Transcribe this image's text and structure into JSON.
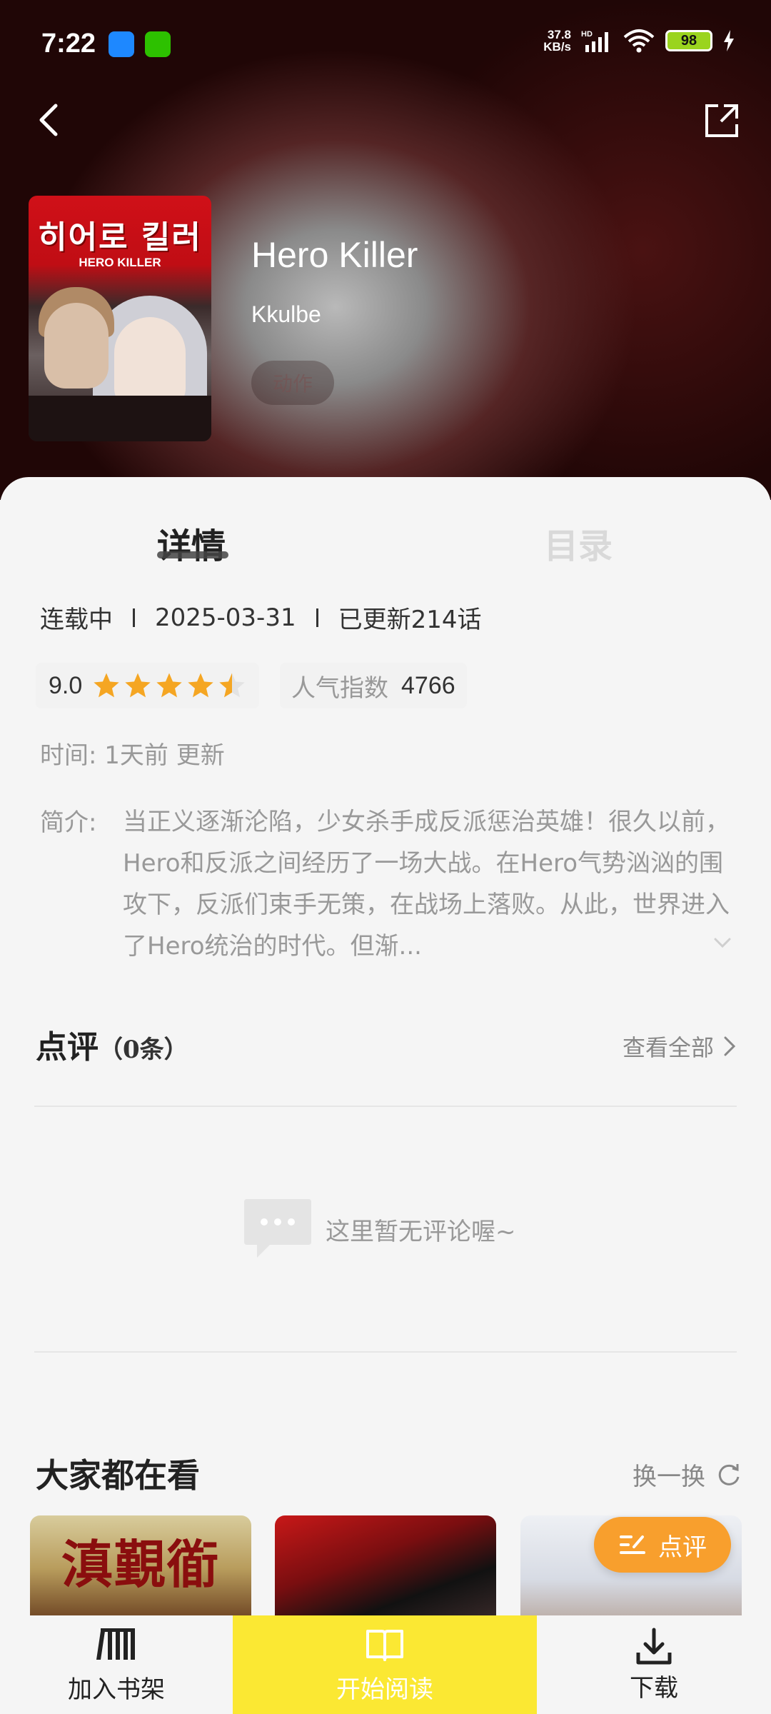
{
  "status_bar": {
    "time": "7:22",
    "net_speed_value": "37.8",
    "net_speed_unit": "KB/s",
    "network_type": "HD",
    "battery": "98"
  },
  "header": {
    "back_icon": "chevron-left-icon",
    "share_icon": "share-icon"
  },
  "comic": {
    "cover_title": "히어로 킬러",
    "cover_subtitle": "HERO KILLER",
    "title": "Hero Killer",
    "author": "Kkulbe",
    "tag": "动作"
  },
  "tabs": [
    {
      "label": "详情",
      "active": true
    },
    {
      "label": "目录",
      "active": false
    }
  ],
  "meta": {
    "status": "连载中",
    "date": "2025-03-31",
    "chapters": "已更新214话"
  },
  "rating": {
    "score": "9.0",
    "stars": 4.5,
    "popularity_label": "人气指数",
    "popularity_value": "4766"
  },
  "update_info": {
    "label": "时间:",
    "value": "1天前 更新"
  },
  "intro": {
    "label": "简介:",
    "text": "当正义逐渐沦陷，少女杀手成反派惩治英雄！很久以前，Hero和反派之间经历了一场大战。在Hero气势汹汹的围攻下，反派们束手无策，在战场上落败。从此，世界进入了Hero统治的时代。但渐..."
  },
  "reviews": {
    "title": "点评",
    "count": "（0条）",
    "view_all": "查看全部",
    "empty_text": "这里暂无评论喔~"
  },
  "recommend": {
    "title": "大家都在看",
    "refresh": "换一换",
    "cards": [
      {
        "cover_text": "滇覲衜"
      },
      {
        "cover_text": ""
      },
      {
        "cover_text": ""
      }
    ]
  },
  "float_button": {
    "label": "点评"
  },
  "bottom_bar": {
    "shelf": "加入书架",
    "read": "开始阅读",
    "download": "下载"
  },
  "colors": {
    "accent_yellow": "#fbe833",
    "review_orange": "#f89f2d",
    "star_orange": "#f5a623"
  }
}
